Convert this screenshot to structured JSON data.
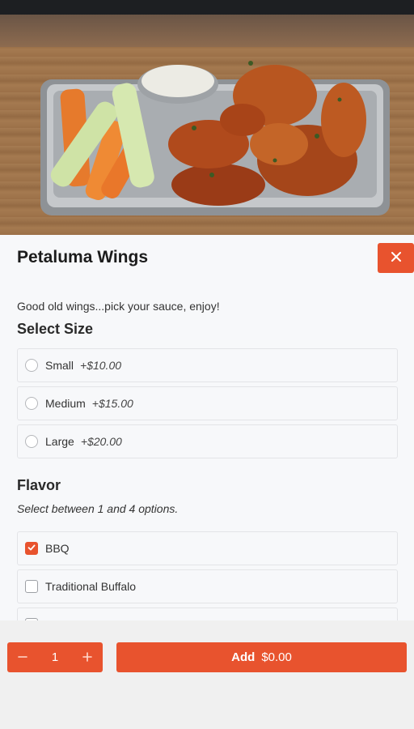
{
  "item": {
    "title": "Petaluma Wings",
    "description": "Good old wings...pick your sauce, enjoy!"
  },
  "size": {
    "title": "Select Size",
    "options": [
      {
        "label": "Small",
        "price": "+$10.00",
        "selected": false
      },
      {
        "label": "Medium",
        "price": "+$15.00",
        "selected": false
      },
      {
        "label": "Large",
        "price": "+$20.00",
        "selected": false
      }
    ]
  },
  "flavor": {
    "title": "Flavor",
    "subtitle": "Select between 1 and 4 options.",
    "options": [
      {
        "label": "BBQ",
        "checked": true
      },
      {
        "label": "Traditional Buffalo",
        "checked": false
      },
      {
        "label": "",
        "checked": false
      }
    ]
  },
  "footer": {
    "quantity": "1",
    "minus_icon": "minus-icon",
    "plus_icon": "plus-icon",
    "add_label": "Add",
    "add_price": "$0.00"
  },
  "colors": {
    "accent": "#e8532e"
  },
  "icons": {
    "close": "close-icon",
    "check": "check-icon"
  }
}
